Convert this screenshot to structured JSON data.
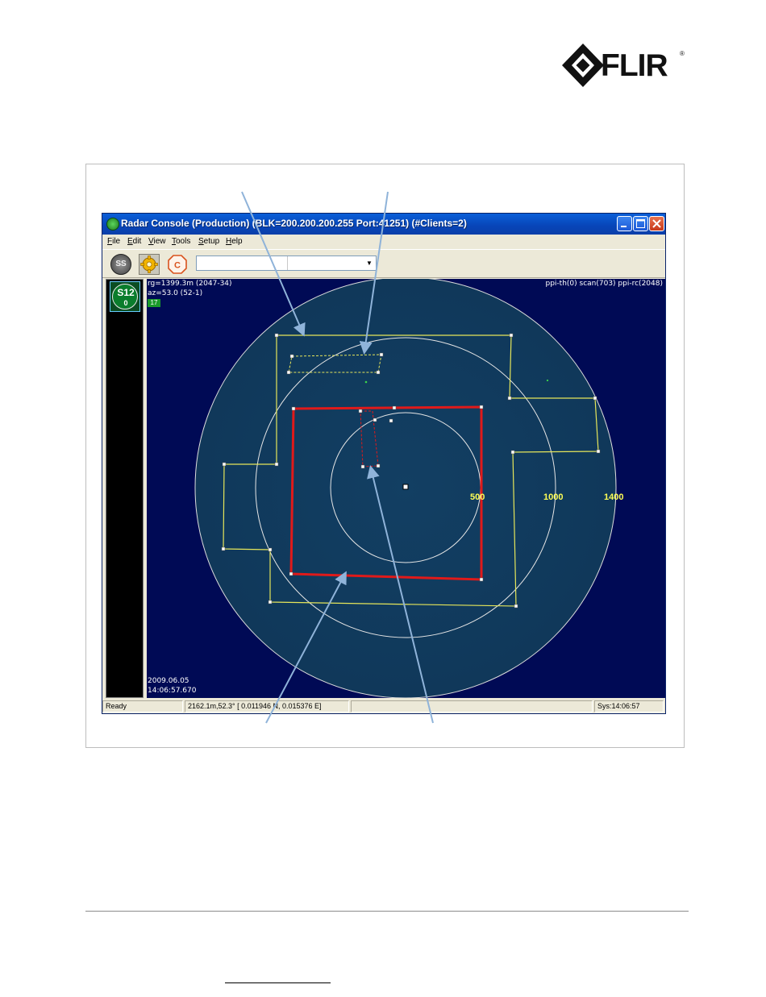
{
  "brand": {
    "logo_text": "FLIR",
    "registered_mark": "®"
  },
  "window": {
    "title": "Radar Console (Production) (BLK=200.200.200.255 Port:41251) (#Clients=2)",
    "controls": [
      "minimize",
      "maximize",
      "close"
    ]
  },
  "menu": [
    "File",
    "Edit",
    "View",
    "Tools",
    "Setup",
    "Help"
  ],
  "toolbar": {
    "ss_label": "SS",
    "c_label": "C",
    "combo_value": ""
  },
  "sensor_badge": {
    "label": "S12",
    "value": "0"
  },
  "radar": {
    "readout_range": "rg=1399.3m (2047-34)",
    "readout_azimuth": "az=53.0 (52-1)",
    "readout_tag": "17",
    "top_right_info": "ppi-th(0) scan(703) ppi-rc(2048)",
    "date": "2009.06.05",
    "time": "14:06:57.670",
    "ring_labels": [
      "500",
      "1000",
      "1400"
    ],
    "ring_color": "#e6e6e6",
    "zone_yellow": "#e6e65a",
    "zone_red": "#e01a1a",
    "background": "#000a55"
  },
  "statusbar": {
    "state": "Ready",
    "cursor_readout": "2162.1m,52.3° [ 0.011946 N,   0.015376 E]",
    "empty_panel": "",
    "sys_time": "Sys:14:06:57"
  },
  "colors": {
    "callout_arrow": "#8fb3d9",
    "title_bar": "#0a5fd8"
  }
}
